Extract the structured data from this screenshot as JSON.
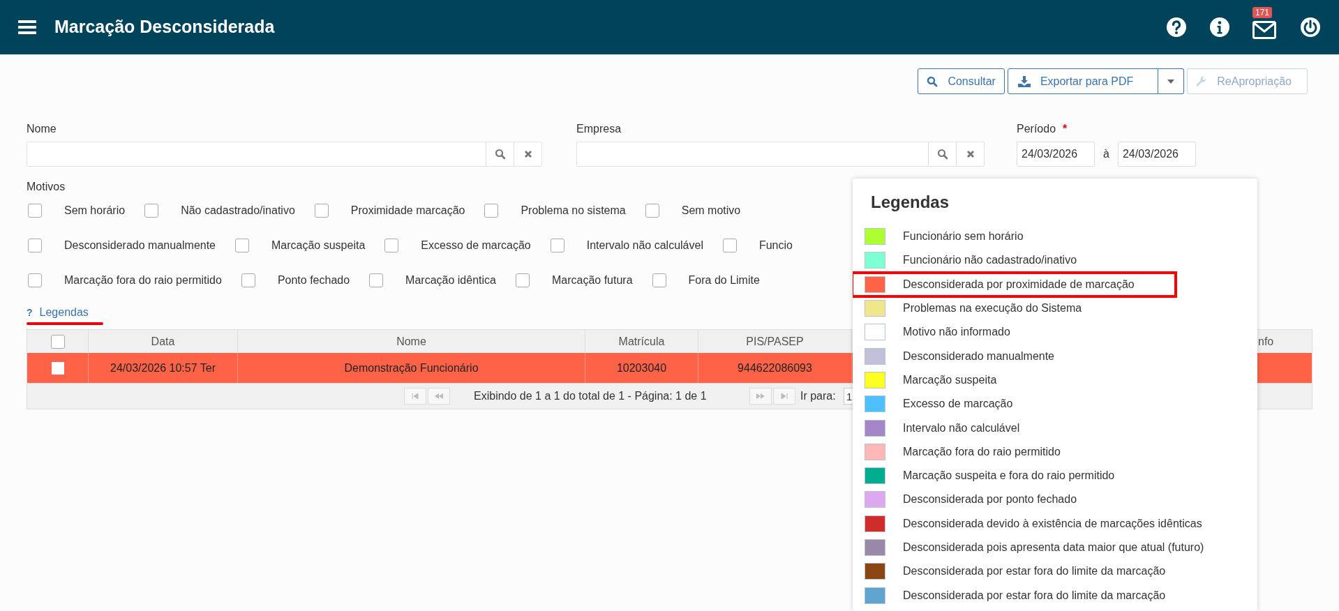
{
  "header": {
    "title": "Marcação Desconsiderada",
    "mail_badge": "171"
  },
  "toolbar": {
    "buttons": [
      {
        "label": "Consultar",
        "kind": "search",
        "disabled": false
      },
      {
        "label": "Exportar para PDF",
        "kind": "export",
        "disabled": false
      },
      {
        "label": "ReApropriação",
        "kind": "wrench",
        "disabled": true
      }
    ]
  },
  "filters": {
    "nome": {
      "label": "Nome"
    },
    "empresa": {
      "label": "Empresa"
    },
    "periodo": {
      "label": "Período",
      "required_mark": "*",
      "start": "24/03/2026",
      "separator": "à",
      "end": "24/03/2026"
    }
  },
  "motivos": {
    "label": "Motivos",
    "rows": [
      [
        {
          "label": "Sem horário",
          "checked": false
        },
        {
          "label": "Não cadastrado/inativo",
          "checked": false
        },
        {
          "label": "Proximidade marcação",
          "checked": false
        },
        {
          "label": "Problema no sistema",
          "checked": false
        },
        {
          "label": "Sem motivo",
          "checked": false
        }
      ],
      [
        {
          "label": "Desconsiderado manualmente",
          "checked": false
        },
        {
          "label": "Marcação suspeita",
          "checked": false
        },
        {
          "label": "Excesso de marcação",
          "checked": false
        },
        {
          "label": "Intervalo não calculável",
          "checked": false
        },
        {
          "label": "Funcio",
          "checked": false
        }
      ],
      [
        {
          "label": "Marcação fora do raio permitido",
          "checked": false
        },
        {
          "label": "Ponto fechado",
          "checked": false
        },
        {
          "label": "Marcação idêntica",
          "checked": false
        },
        {
          "label": "Marcação futura",
          "checked": false
        },
        {
          "label": "Fora do Limite",
          "checked": false
        }
      ]
    ]
  },
  "legend_link": {
    "icon_text": "?",
    "label": "Legendas"
  },
  "table": {
    "header_checked": false,
    "columns": [
      "Data",
      "Nome",
      "Matrícula",
      "PIS/PASEP",
      "nfo"
    ],
    "rows": [
      {
        "checked": false,
        "color": "#ff6347",
        "cells": [
          "24/03/2026 10:57 Ter",
          "Demonstração Funcionário",
          "10203040",
          "944622086093"
        ]
      }
    ],
    "pager": {
      "info": "Exibindo de 1 a 1 do total de 1 - Página: 1 de 1",
      "goto_label": "Ir para:",
      "goto_value": "1"
    }
  },
  "legend_popup": {
    "title": "Legendas",
    "items": [
      {
        "label": "Funcionário sem horário",
        "color": "#adff2f",
        "highlighted": false
      },
      {
        "label": "Funcionário não cadastrado/inativo",
        "color": "#7fffd4",
        "highlighted": false
      },
      {
        "label": "Desconsiderada por proximidade de marcação",
        "color": "#ff6347",
        "highlighted": true
      },
      {
        "label": "Problemas na execução do Sistema",
        "color": "#f0e68c",
        "highlighted": false
      },
      {
        "label": "Motivo não informado",
        "color": "#ffffff",
        "highlighted": false
      },
      {
        "label": "Desconsiderado manualmente",
        "color": "#c0c0d8",
        "highlighted": false
      },
      {
        "label": "Marcação suspeita",
        "color": "#ffff22",
        "highlighted": false
      },
      {
        "label": "Excesso de marcação",
        "color": "#4fc0ff",
        "highlighted": false
      },
      {
        "label": "Intervalo não calculável",
        "color": "#a385c8",
        "highlighted": false
      },
      {
        "label": "Marcação fora do raio permitido",
        "color": "#ffb6b6",
        "highlighted": false
      },
      {
        "label": "Marcação suspeita e fora do raio permitido",
        "color": "#00ad8f",
        "highlighted": false
      },
      {
        "label": "Desconsiderada por ponto fechado",
        "color": "#dea8f0",
        "highlighted": false
      },
      {
        "label": "Desconsiderada devido à existência de marcações idênticas",
        "color": "#d02c2c",
        "highlighted": false
      },
      {
        "label": "Desconsiderada pois apresenta data maior que atual (futuro)",
        "color": "#9a88a8",
        "highlighted": false
      },
      {
        "label": "Desconsiderada por estar fora do limite da marcação",
        "color": "#8b4513",
        "highlighted": false
      },
      {
        "label": "Desconsiderada por estar fora do limite da marcação",
        "color": "#5fa5d0",
        "highlighted": false
      }
    ]
  }
}
